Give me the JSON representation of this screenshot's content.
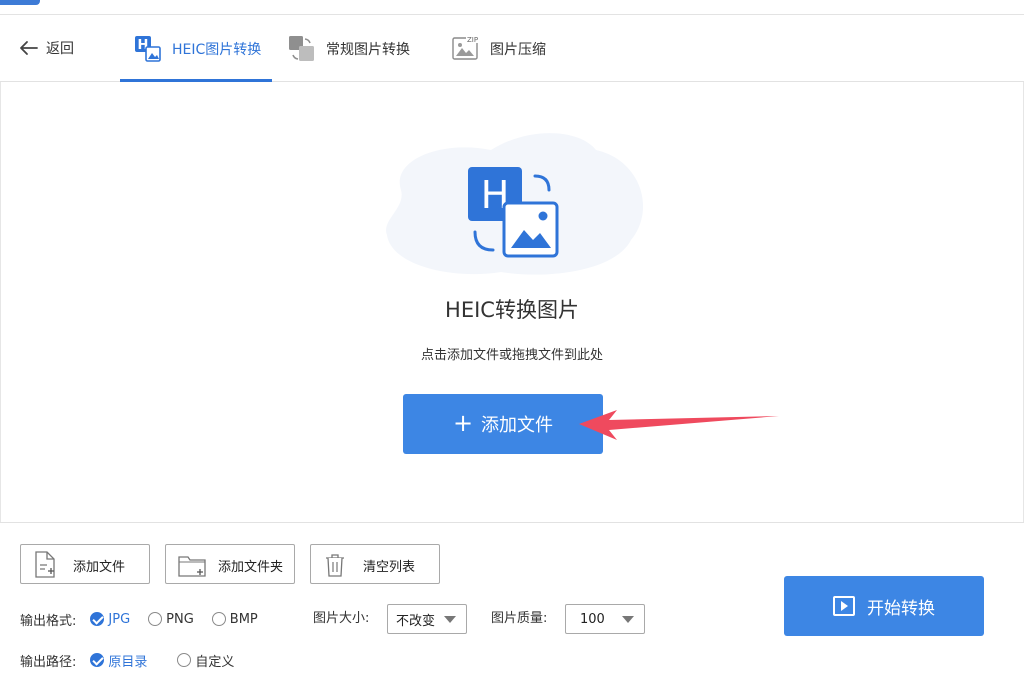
{
  "nav": {
    "back_label": "返回",
    "tabs": [
      {
        "label": "HEIC图片转换",
        "icon": "heic-convert-icon",
        "active": true
      },
      {
        "label": "常规图片转换",
        "icon": "image-convert-icon",
        "active": false
      },
      {
        "label": "图片压缩",
        "icon": "zip-image-icon",
        "active": false
      }
    ],
    "zip_badge": "ZIP"
  },
  "hero": {
    "icon_letter": "H",
    "title": "HEIC转换图片",
    "subtitle": "点击添加文件或拖拽文件到此处",
    "add_button_label": "添加文件"
  },
  "toolbar": {
    "add_file_label": "添加文件",
    "add_folder_label": "添加文件夹",
    "clear_list_label": "清空列表"
  },
  "settings": {
    "format_label": "输出格式:",
    "formats": [
      {
        "label": "JPG",
        "selected": true
      },
      {
        "label": "PNG",
        "selected": false
      },
      {
        "label": "BMP",
        "selected": false
      }
    ],
    "size_label": "图片大小:",
    "size_value": "不改变",
    "quality_label": "图片质量:",
    "quality_value": "100",
    "path_label": "输出路径:",
    "paths": [
      {
        "label": "原目录",
        "selected": true
      },
      {
        "label": "自定义",
        "selected": false
      }
    ]
  },
  "start_button_label": "开始转换",
  "colors": {
    "accent": "#2f74d8",
    "button_blue": "#3d86e4",
    "arrow_red": "#ef4a5e",
    "blob": "#f3f6fb"
  }
}
